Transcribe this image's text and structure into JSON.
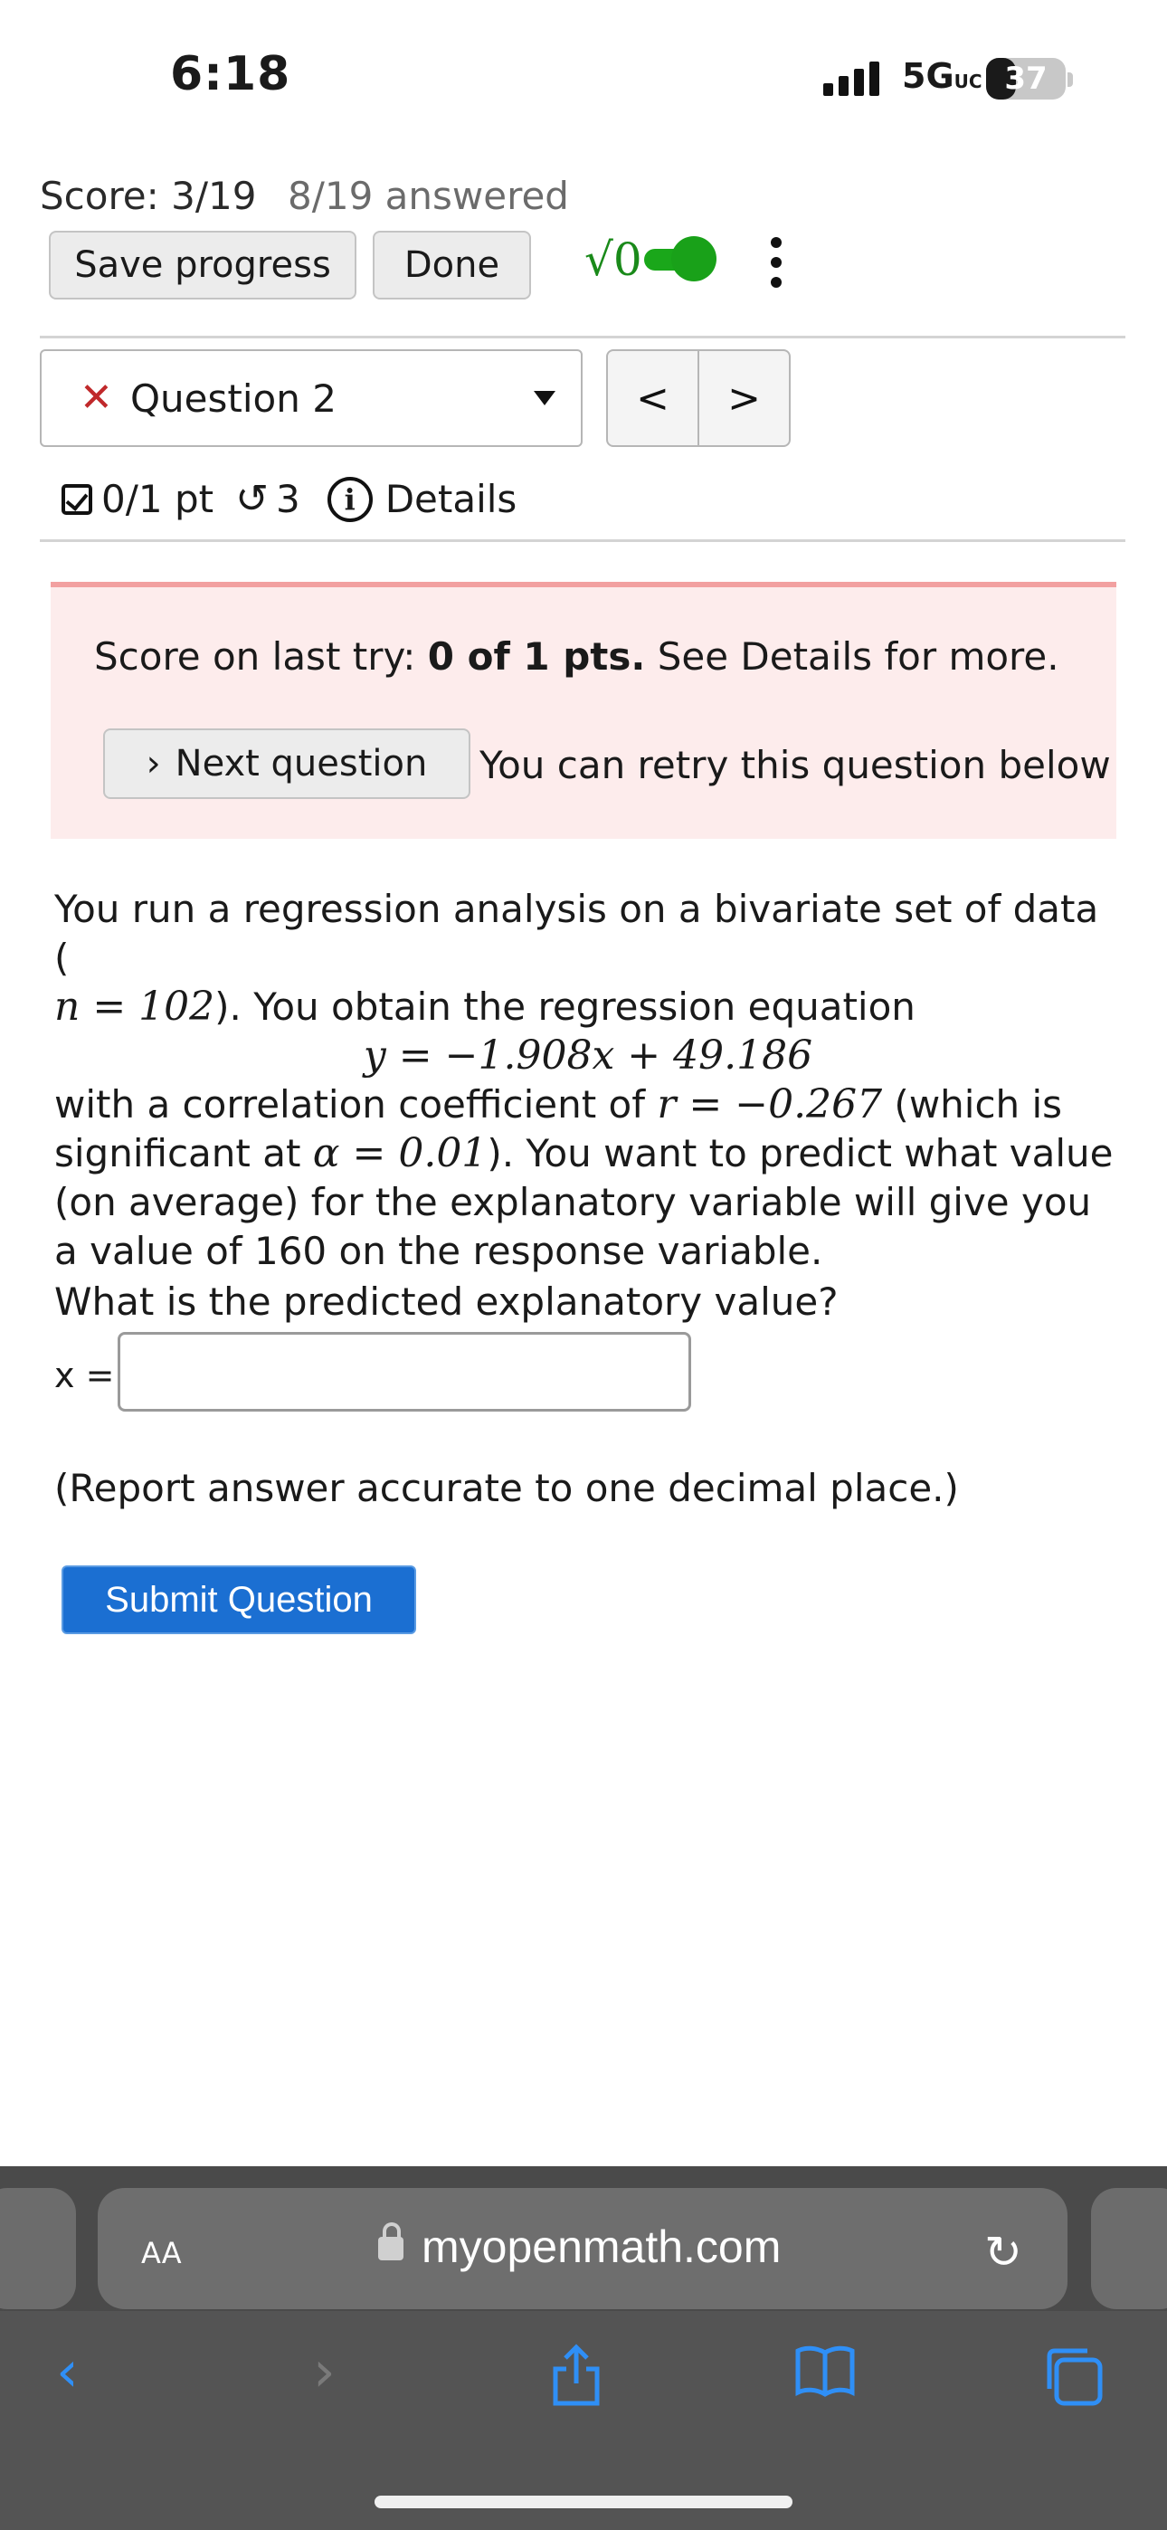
{
  "status_bar": {
    "time": "6:18",
    "network": "5G",
    "network_sub": "UC",
    "battery": "37",
    "battery_level": 0.37
  },
  "header": {
    "score": "Score: 3/19",
    "answered": "8/19 answered",
    "save_label": "Save progress",
    "done_label": "Done",
    "mathjax_icon": "√0"
  },
  "question_nav": {
    "selected": "Question 2",
    "prev": "<",
    "next": ">"
  },
  "meta": {
    "points": "0/1 pt",
    "tries": "3",
    "details": "Details"
  },
  "alert": {
    "score_prefix": "Score on last try: ",
    "score_value": "0 of 1 pts.",
    "score_suffix": " See Details for more.",
    "next_question": "Next question",
    "retry_text": "You can retry this question below"
  },
  "problem": {
    "line1": "You run a regression analysis on a bivariate set of data (",
    "n_eq": "n = 102",
    "line1b": "). You obtain the regression equation",
    "equation": "y = −1.908x + 49.186",
    "line2a": "with a correlation coefficient of ",
    "r_eq": "r = −0.267",
    "line2b": " (which is significant at ",
    "alpha_eq": "α = 0.01",
    "line2c": "). You want to predict what value (on average) for the explanatory variable will give you a value of 160 on the response variable.",
    "question": "What is the predicted explanatory value?",
    "answer_label": "x =",
    "answer_value": "",
    "report": "(Report answer accurate to one decimal place.)",
    "submit": "Submit Question"
  },
  "browser": {
    "aa_label": "AA",
    "url": "myopenmath.com"
  },
  "colors": {
    "accent": "#1b6fd2",
    "alert_bg": "#fdecec",
    "alert_border": "#f2a0a0",
    "error_x": "#c0292b",
    "toggle": "#1aa71a",
    "safari_blue": "#2f8ff6"
  }
}
